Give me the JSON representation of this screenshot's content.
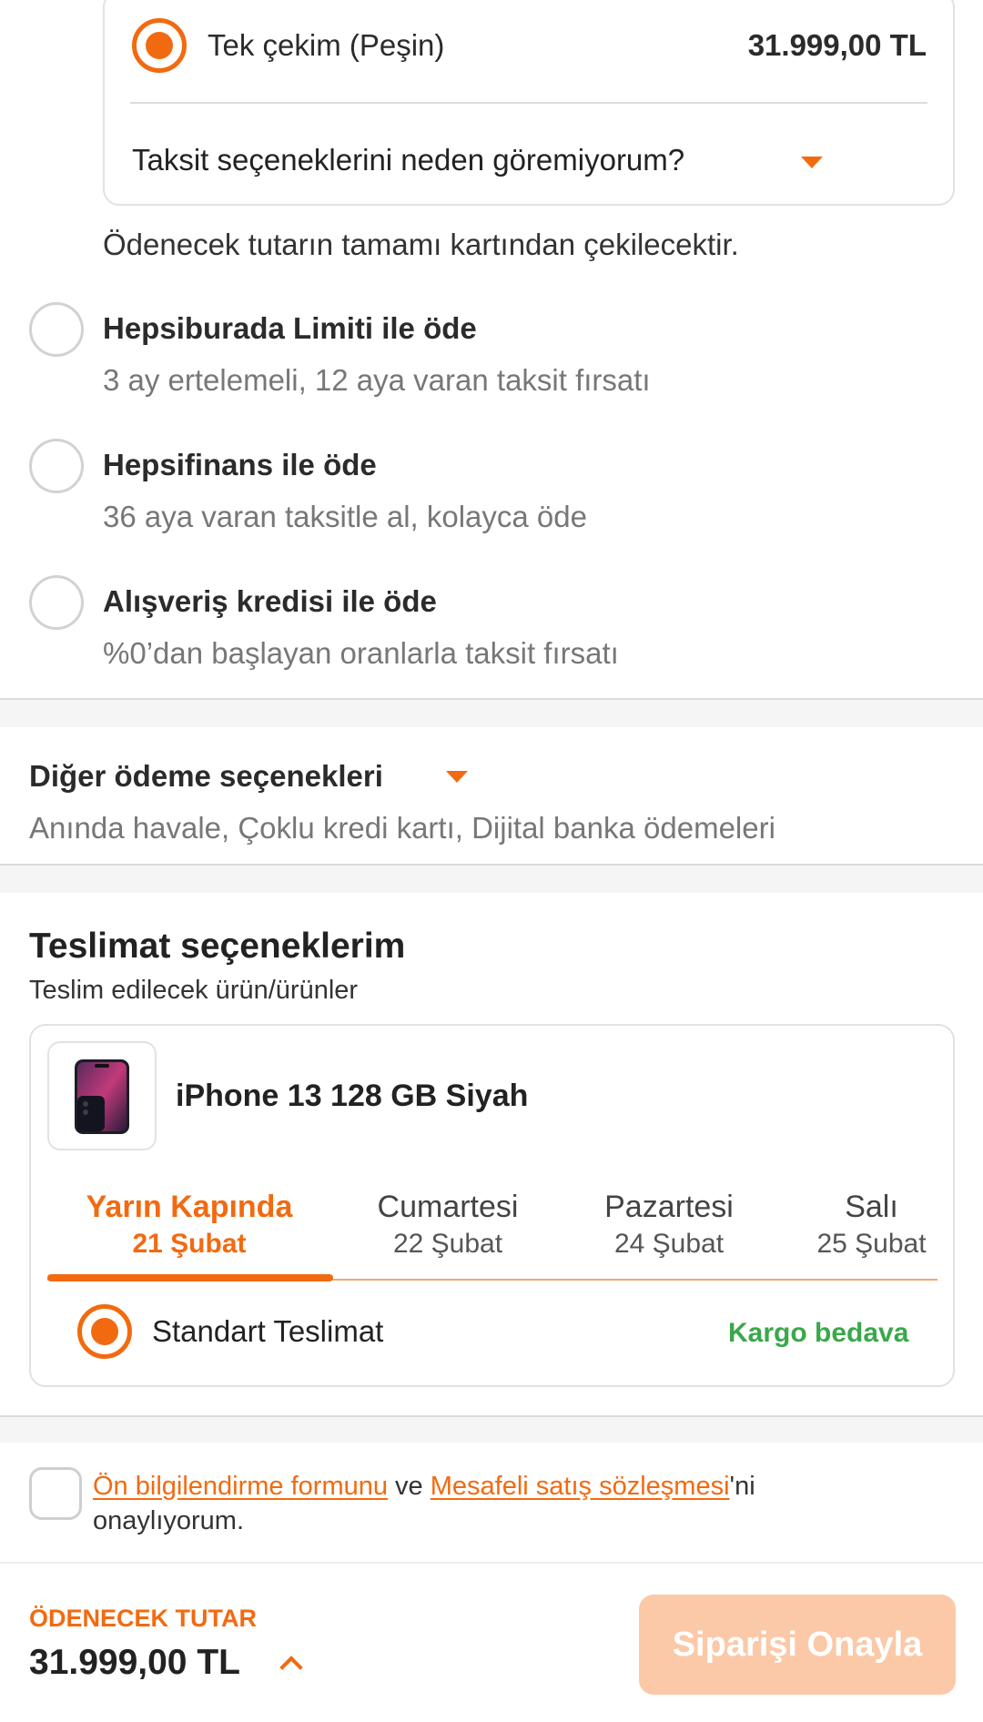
{
  "payment": {
    "single": {
      "label": "Tek çekim (Peşin)",
      "amount": "31.999,00 TL"
    },
    "installment_question": "Taksit seçeneklerini neden göremiyorum?",
    "note": "Ödenecek tutarın tamamı kartından çekilecektir.",
    "options": [
      {
        "title": "Hepsiburada Limiti ile öde",
        "subtitle": "3 ay ertelemeli, 12 aya varan taksit fırsatı"
      },
      {
        "title": "Hepsifinans ile öde",
        "subtitle": "36 aya varan taksitle al, kolayca öde"
      },
      {
        "title": "Alışveriş kredisi ile öde",
        "subtitle": "%0’dan başlayan oranlarla taksit fırsatı"
      }
    ]
  },
  "other_payments": {
    "title": "Diğer ödeme seçenekleri",
    "subtitle": "Anında havale, Çoklu kredi kartı, Dijital banka ödemeleri"
  },
  "delivery": {
    "title": "Teslimat seçeneklerim",
    "subtitle": "Teslim edilecek ürün/ürünler",
    "product_name": "iPhone 13 128 GB Siyah",
    "tabs": [
      {
        "day": "Yarın Kapında",
        "date": "21 Şubat"
      },
      {
        "day": "Cumartesi",
        "date": "22 Şubat"
      },
      {
        "day": "Pazartesi",
        "date": "24 Şubat"
      },
      {
        "day": "Salı",
        "date": "25 Şubat"
      }
    ],
    "method": "Standart Teslimat",
    "shipping_note": "Kargo bedava"
  },
  "agreement": {
    "link1": "Ön bilgilendirme formunu",
    "connector": "ve",
    "link2": "Mesafeli satış sözleşmesi",
    "suffix": "'ni",
    "line2": "onaylıyorum."
  },
  "footer": {
    "total_label": "ÖDENECEK TUTAR",
    "total_amount": "31.999,00 TL",
    "confirm_label": "Siparişi Onayla"
  },
  "colors": {
    "accent": "#f26a10",
    "success": "#3aa84a",
    "disabled_button": "#fbc9a8"
  }
}
